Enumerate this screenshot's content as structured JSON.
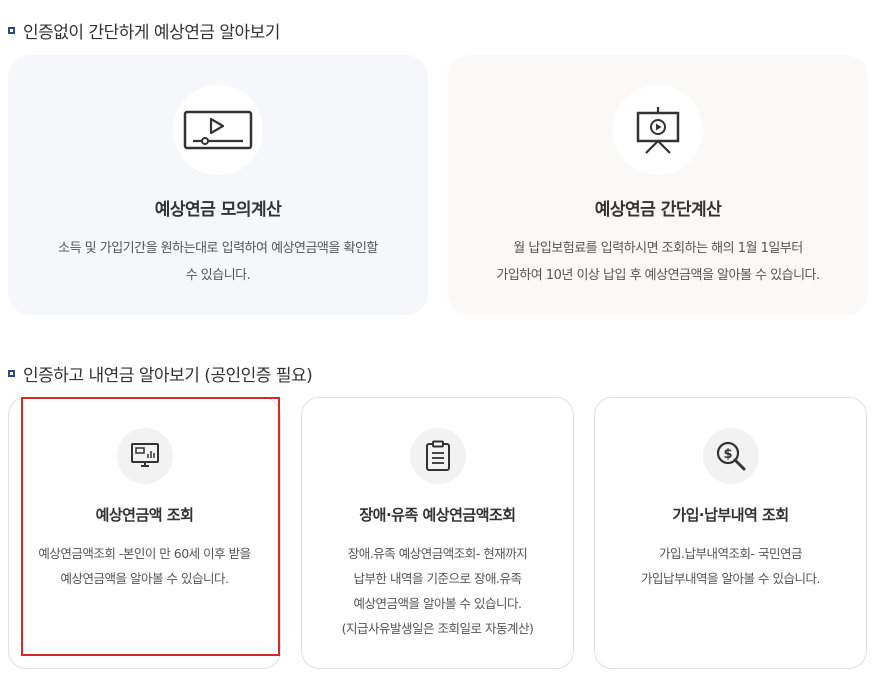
{
  "section1": {
    "title": "인증없이 간단하게 예상연금 알아보기",
    "cards": [
      {
        "title": "예상연금 모의계산",
        "desc_line1": "소득 및 가입기간을 원하는대로 입력하여 예상연금액을 확인할",
        "desc_line2": "수 있습니다.",
        "icon": "video-player-icon"
      },
      {
        "title": "예상연금 간단계산",
        "desc_line1": "월 납입보험료를 입력하시면 조회하는 해의 1월 1일부터",
        "desc_line2": "가입하여 10년 이상 납입 후 예상연금액을 알아볼 수 있습니다.",
        "icon": "presentation-easel-icon"
      }
    ]
  },
  "section2": {
    "title": "인증하고 내연금 알아보기 (공인인증 필요)",
    "cards": [
      {
        "title": "예상연금액 조회",
        "desc_lines": [
          "예상연금액조회 -본인이 만 60세 이후 받을",
          "예상연금액을 알아볼 수 있습니다."
        ],
        "icon": "monitor-chart-icon"
      },
      {
        "title": "장애·유족 예상연금액조회",
        "desc_lines": [
          "장애.유족 예상연금액조회- 현재까지",
          "납부한 내역을 기준으로 장애.유족",
          "예상연금액을 알아볼 수 있습니다.",
          "(지급사유발생일은 조회일로 자동계산)"
        ],
        "icon": "clipboard-icon"
      },
      {
        "title": "가입·납부내역 조회",
        "desc_lines": [
          "가입.납부내역조회- 국민연금",
          "가입납부내역을 알아볼 수 있습니다."
        ],
        "icon": "dollar-search-icon"
      }
    ]
  },
  "colors": {
    "bullet": "#2b4a8a",
    "highlight": "#d42a2a",
    "card1_bg": "#f6f7fa",
    "card2_bg": "#faf9f7"
  }
}
